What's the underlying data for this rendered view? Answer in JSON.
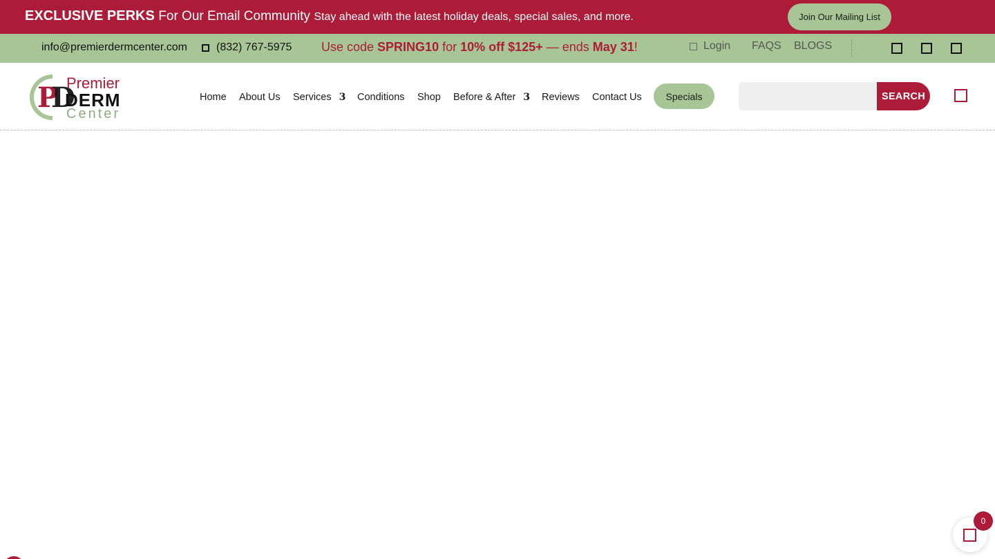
{
  "promo": {
    "title": "EXCLUSIVE PERKS",
    "subtitle": "For Our Email Community",
    "description": "Stay ahead with the latest holiday deals, special sales, and more.",
    "button": "Join Our Mailing List"
  },
  "info_bar": {
    "email": "info@premierdermcenter.com",
    "phone": "(832) 767-5975",
    "code_message": {
      "prefix": "Use code ",
      "code": "SPRING10",
      "middle": " for ",
      "discount": "10% off $125+",
      "dash": " — ends ",
      "end_date": "May 31",
      "suffix": "!"
    },
    "login": "Login",
    "faqs": "FAQS",
    "blogs": "BLOGS"
  },
  "logo": {
    "line1": "Premier",
    "line2": "DERM",
    "line3": "Center",
    "monogram": "PD"
  },
  "nav": {
    "items": [
      "Home",
      "About Us",
      "Services",
      "Conditions",
      "Shop",
      "Before & After",
      "Reviews",
      "Contact Us"
    ],
    "caret": "3",
    "specials": "Specials"
  },
  "search": {
    "placeholder": "",
    "button": "SEARCH"
  },
  "cart": {
    "count": "0"
  },
  "colors": {
    "brand_red": "#ac1c38",
    "brand_green": "#a8c695"
  },
  "icons": {
    "phone": "phone-icon",
    "login": "user-icon",
    "social": [
      "facebook-icon",
      "instagram-icon",
      "youtube-icon"
    ],
    "cart": "cart-icon"
  }
}
